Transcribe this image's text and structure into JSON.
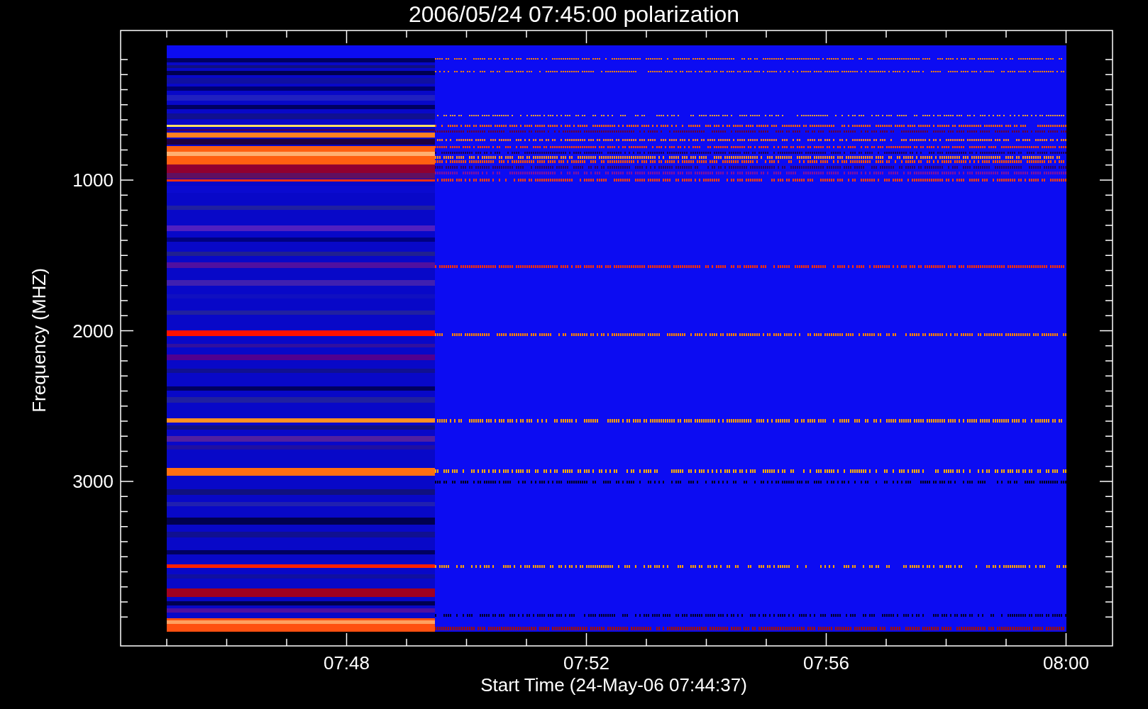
{
  "title": "2006/05/24 07:45:00 polarization",
  "y_axis": {
    "label": "Frequency (MHZ)",
    "ticks": [
      "1000",
      "2000",
      "3000"
    ]
  },
  "x_axis": {
    "label": "Start Time (24-May-06 07:44:37)",
    "ticks": [
      "07:48",
      "07:52",
      "07:56",
      "08:00"
    ]
  }
}
